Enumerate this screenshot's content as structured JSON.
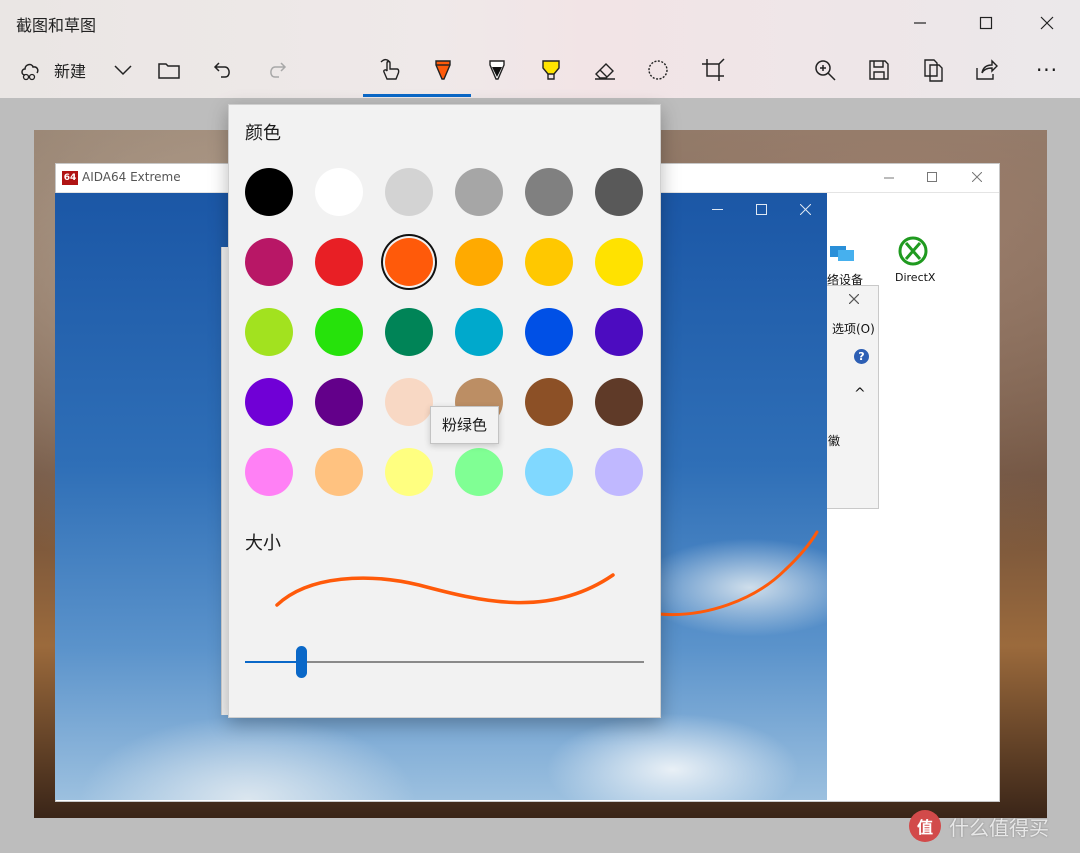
{
  "window": {
    "title": "截图和草图",
    "minimize_icon": "minimize-icon",
    "maximize_icon": "maximize-icon",
    "close_icon": "close-icon"
  },
  "toolbar": {
    "new_label": "新建",
    "tools": [
      {
        "name": "touch-writing",
        "icon": "touch-writing-icon"
      },
      {
        "name": "ballpoint-pen",
        "icon": "ballpoint-pen-icon",
        "active": true,
        "color": "#ff5a0a"
      },
      {
        "name": "pencil",
        "icon": "pencil-icon"
      },
      {
        "name": "highlighter",
        "icon": "highlighter-icon",
        "color": "#ffe400"
      },
      {
        "name": "eraser",
        "icon": "eraser-icon"
      },
      {
        "name": "ruler",
        "icon": "ruler-protractor-icon"
      },
      {
        "name": "crop",
        "icon": "crop-icon"
      }
    ],
    "right_tools": [
      "zoom-in-icon",
      "save-icon",
      "copy-icon",
      "share-icon",
      "more-icon"
    ],
    "more_label": "···",
    "accent": "#0a68c8"
  },
  "color_panel": {
    "color_heading": "颜色",
    "size_heading": "大小",
    "selected_color": "#ff5a0a",
    "tooltip": "粉绿色",
    "swatches": [
      [
        "#000000",
        "#ffffff",
        "#d3d3d3",
        "#a6a6a6",
        "#808080",
        "#595959"
      ],
      [
        "#b81766",
        "#e81f25",
        "#ff5a0a",
        "#ffaa00",
        "#ffc800",
        "#ffe200"
      ],
      [
        "#a2e21f",
        "#26e20b",
        "#008457",
        "#00a9cc",
        "#0050e6",
        "#4c0cc0"
      ],
      [
        "#7000d6",
        "#63008a",
        "#f8d8c4",
        "#bc8e64",
        "#8c5026",
        "#5f3a28"
      ],
      [
        "#ff80f5",
        "#ffc280",
        "#ffff80",
        "#80ff94",
        "#80d8ff",
        "#c0b8ff"
      ]
    ],
    "size_level": 0.14
  },
  "inner_app": {
    "title": "AIDA64 Extreme",
    "logo_text": "64",
    "item_network": "络设备",
    "item_directx": "DirectX",
    "dialog_menu": "选项(O)",
    "dialog_help": "?",
    "dialog_chevron": "^",
    "dialog_partial": "徽"
  },
  "watermark": {
    "logo_text": "值",
    "text": "什么值得买"
  }
}
